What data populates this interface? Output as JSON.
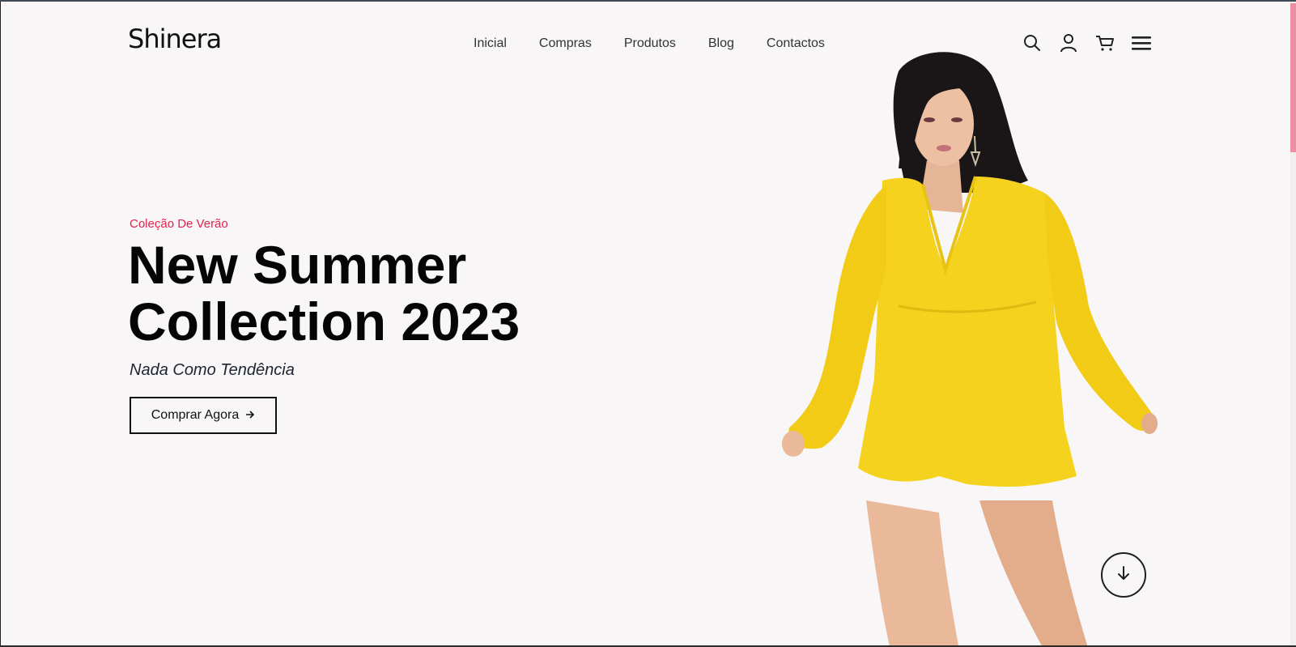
{
  "header": {
    "logo": "Shinera",
    "nav": [
      "Inicial",
      "Compras",
      "Produtos",
      "Blog",
      "Contactos"
    ],
    "icons": [
      "search-icon",
      "user-icon",
      "cart-icon",
      "menu-icon"
    ]
  },
  "hero": {
    "eyebrow": "Coleção De Verão",
    "headline_line1": "New Summer",
    "headline_line2": "Collection 2023",
    "tagline": "Nada Como Tendência",
    "cta_label": "Comprar Agora",
    "cta_icon": "arrow-right-icon",
    "scroll_icon": "arrow-down-icon"
  },
  "colors": {
    "accent": "#e3224c",
    "background": "#f8f6f7",
    "text": "#050505",
    "dress": "#f5d21d",
    "scrollbar": "#ec8ea4"
  }
}
